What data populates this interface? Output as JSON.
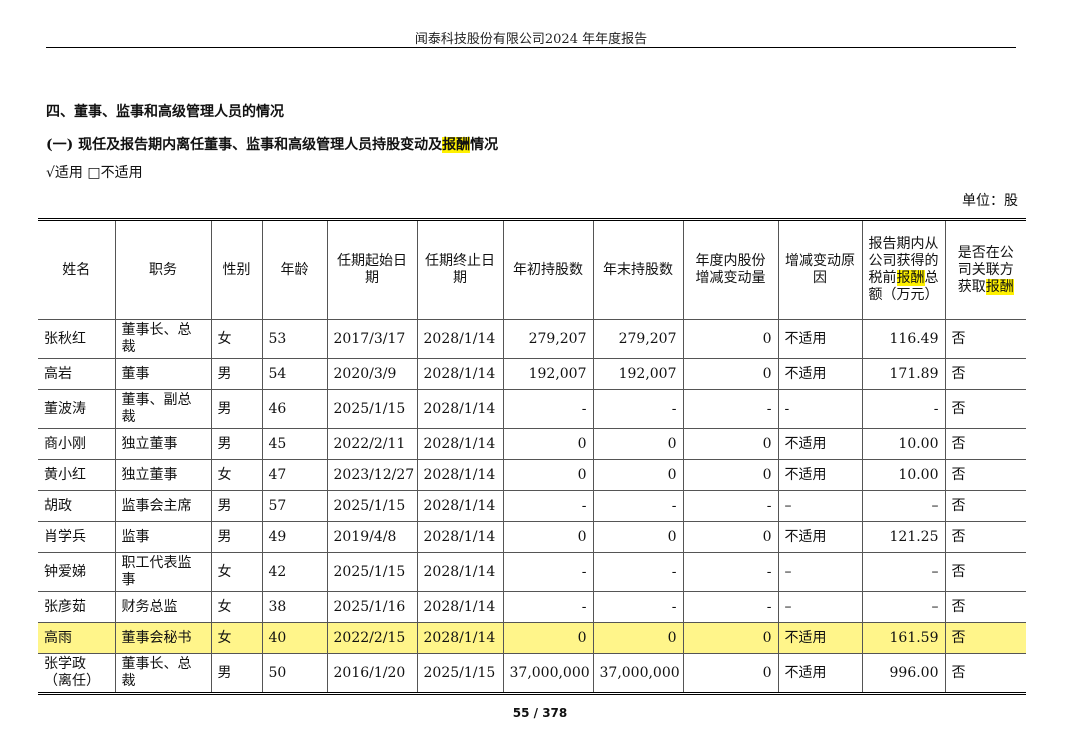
{
  "header": {
    "title": "闻泰科技股份有限公司2024 年年度报告"
  },
  "section": {
    "title": "四、董事、监事和高级管理人员的情况",
    "subtitle_pre": "(一)  现任及报告期内离任董事、监事和高级管理人员持股变动及",
    "subtitle_hl": "报酬",
    "subtitle_post": "情况",
    "applicable_label": "√适用  □不适用",
    "unit_label": "单位：股"
  },
  "table": {
    "headers": {
      "name": "姓名",
      "position": "职务",
      "gender": "性别",
      "age": "年龄",
      "start": "任期起始日期",
      "end": "任期终止日期",
      "begin_shares": "年初持股数",
      "end_shares": "年末持股数",
      "change": "年度内股份增减变动量",
      "reason": "增减变动原因",
      "pay_pre": "报告期内从公司获得的税前",
      "pay_hl": "报酬",
      "pay_post": "总额（万元）",
      "related_pre": "是否在公司关联方获取",
      "related_hl": "报酬"
    },
    "rows": [
      {
        "name": "张秋红",
        "position": "董事长、总裁",
        "gender": "女",
        "age": "53",
        "start": "2017/3/17",
        "end": "2028/1/14",
        "begin_shares": "279,207",
        "end_shares": "279,207",
        "change": "0",
        "reason": "不适用",
        "pay": "116.49",
        "related": "否"
      },
      {
        "name": "高岩",
        "position": "董事",
        "gender": "男",
        "age": "54",
        "start": "2020/3/9",
        "end": "2028/1/14",
        "begin_shares": "192,007",
        "end_shares": "192,007",
        "change": "0",
        "reason": "不适用",
        "pay": "171.89",
        "related": "否"
      },
      {
        "name": "董波涛",
        "position": "董事、副总裁",
        "gender": "男",
        "age": "46",
        "start": "2025/1/15",
        "end": "2028/1/14",
        "begin_shares": "-",
        "end_shares": "-",
        "change": "-",
        "reason": "-",
        "pay": "-",
        "related": "否"
      },
      {
        "name": "商小刚",
        "position": "独立董事",
        "gender": "男",
        "age": "45",
        "start": "2022/2/11",
        "end": "2028/1/14",
        "begin_shares": "0",
        "end_shares": "0",
        "change": "0",
        "reason": "不适用",
        "pay": "10.00",
        "related": "否"
      },
      {
        "name": "黄小红",
        "position": "独立董事",
        "gender": "女",
        "age": "47",
        "start": "2023/12/27",
        "end": "2028/1/14",
        "begin_shares": "0",
        "end_shares": "0",
        "change": "0",
        "reason": "不适用",
        "pay": "10.00",
        "related": "否"
      },
      {
        "name": "胡政",
        "position": "监事会主席",
        "gender": "男",
        "age": "57",
        "start": "2025/1/15",
        "end": "2028/1/14",
        "begin_shares": "-",
        "end_shares": "-",
        "change": "-",
        "reason": "–",
        "pay": "–",
        "related": "否"
      },
      {
        "name": "肖学兵",
        "position": "监事",
        "gender": "男",
        "age": "49",
        "start": "2019/4/8",
        "end": "2028/1/14",
        "begin_shares": "0",
        "end_shares": "0",
        "change": "0",
        "reason": "不适用",
        "pay": "121.25",
        "related": "否"
      },
      {
        "name": "钟爱娣",
        "position": "职工代表监事",
        "gender": "女",
        "age": "42",
        "start": "2025/1/15",
        "end": "2028/1/14",
        "begin_shares": "-",
        "end_shares": "-",
        "change": "-",
        "reason": "–",
        "pay": "–",
        "related": "否"
      },
      {
        "name": "张彦茹",
        "position": "财务总监",
        "gender": "女",
        "age": "38",
        "start": "2025/1/16",
        "end": "2028/1/14",
        "begin_shares": "-",
        "end_shares": "-",
        "change": "-",
        "reason": "–",
        "pay": "–",
        "related": "否"
      },
      {
        "name": "高雨",
        "position": "董事会秘书",
        "gender": "女",
        "age": "40",
        "start": "2022/2/15",
        "end": "2028/1/14",
        "begin_shares": "0",
        "end_shares": "0",
        "change": "0",
        "reason": "不适用",
        "pay": "161.59",
        "related": "否"
      },
      {
        "name": "张学政（离任）",
        "position": "董事长、总裁",
        "gender": "男",
        "age": "50",
        "start": "2016/1/20",
        "end": "2025/1/15",
        "begin_shares": "37,000,000",
        "end_shares": "37,000,000",
        "change": "0",
        "reason": "不适用",
        "pay": "996.00",
        "related": "否"
      }
    ]
  },
  "footer": {
    "page": "55 / 378"
  },
  "colors": {
    "highlight_text": "#fff100",
    "highlight_row": "#fff58a"
  }
}
